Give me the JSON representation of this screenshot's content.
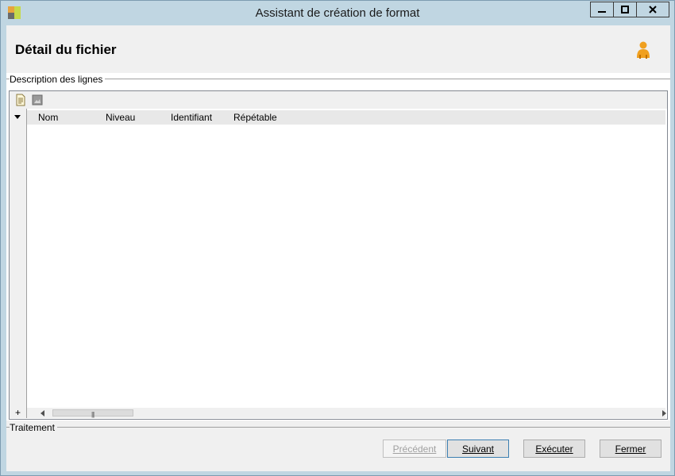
{
  "window": {
    "title": "Assistant de création de format",
    "icon": "app-icon",
    "controls": {
      "minimize": "minimize-icon",
      "maximize": "maximize-icon",
      "close": "close-icon"
    }
  },
  "header": {
    "title": "Détail du fichier",
    "icon": "user-icon"
  },
  "lines_group": {
    "label": "Description des lignes",
    "toolbar": [
      "new-document-icon",
      "image-icon"
    ],
    "columns": [
      "Nom",
      "Niveau",
      "Identifiant",
      "Répétable"
    ],
    "rows": [],
    "add_label": "+"
  },
  "treatment_group": {
    "label": "Traitement"
  },
  "buttons": {
    "previous": "Précédent",
    "next": "Suivant",
    "execute": "Exécuter",
    "close": "Fermer"
  }
}
